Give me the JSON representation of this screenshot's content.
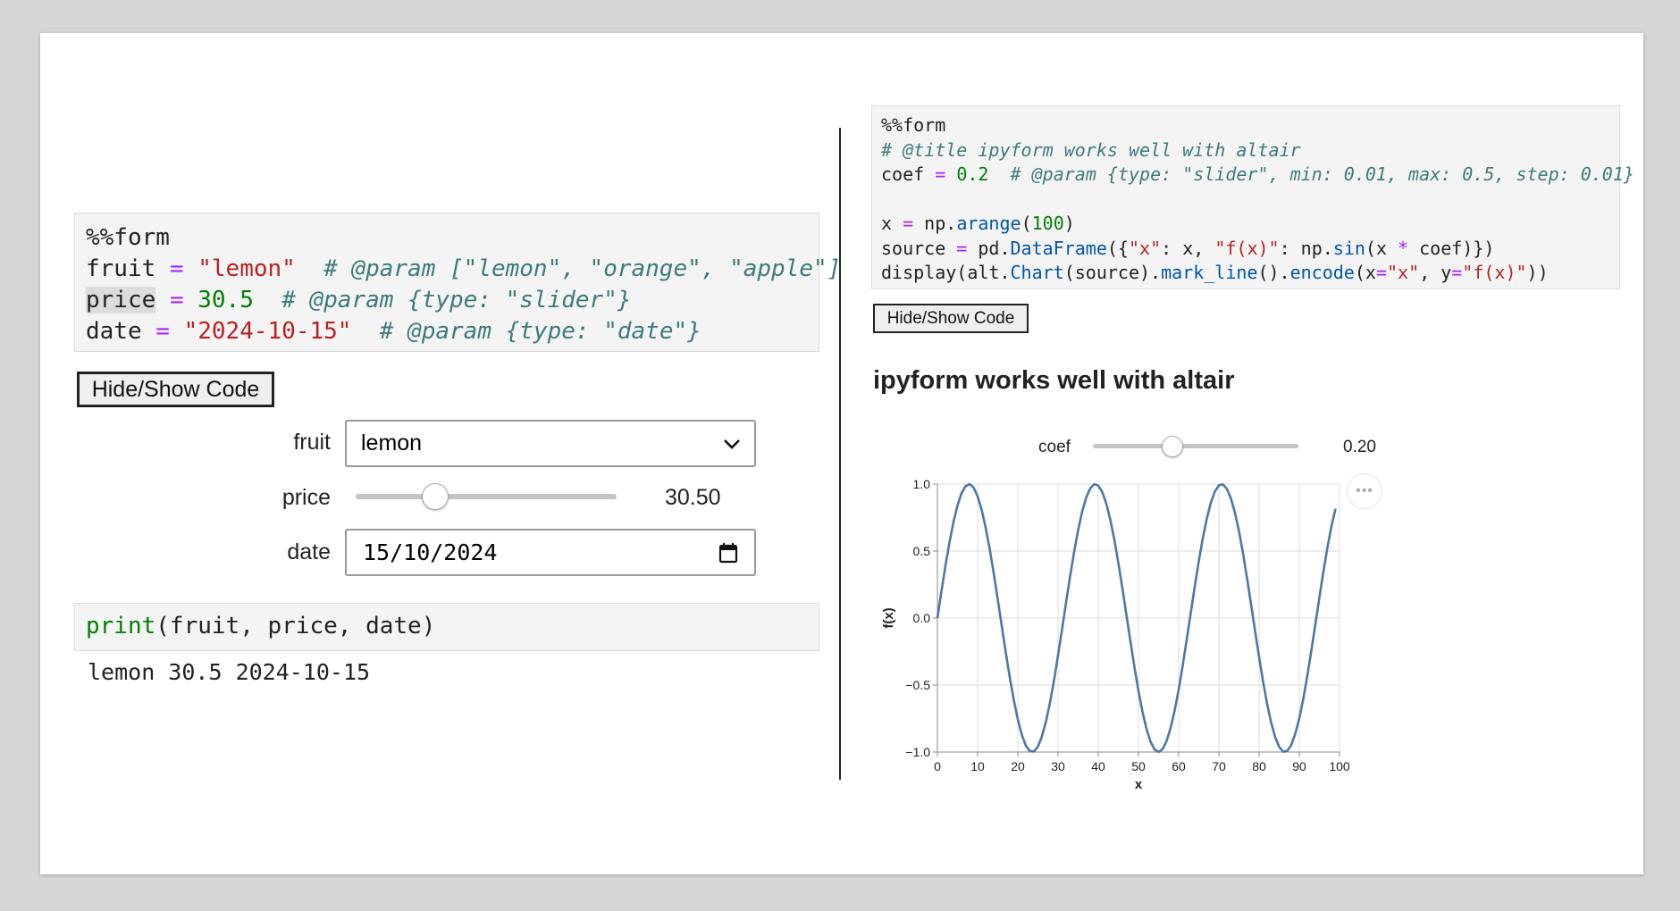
{
  "left": {
    "code_lines": [
      [
        {
          "t": "%%form",
          "c": ""
        }
      ],
      [
        {
          "t": "fruit ",
          "c": ""
        },
        {
          "t": "=",
          "c": "kw-op"
        },
        {
          "t": " ",
          "c": ""
        },
        {
          "t": "\"lemon\"",
          "c": "str"
        },
        {
          "t": "  ",
          "c": ""
        },
        {
          "t": "# @param [\"lemon\", \"orange\", \"apple\"]",
          "c": "com"
        }
      ],
      [
        {
          "t": "price",
          "c": "hl"
        },
        {
          "t": " ",
          "c": ""
        },
        {
          "t": "=",
          "c": "kw-op"
        },
        {
          "t": " ",
          "c": ""
        },
        {
          "t": "30.5",
          "c": "num"
        },
        {
          "t": "  ",
          "c": ""
        },
        {
          "t": "# @param {type: \"slider\"}",
          "c": "com"
        }
      ],
      [
        {
          "t": "date ",
          "c": ""
        },
        {
          "t": "=",
          "c": "kw-op"
        },
        {
          "t": " ",
          "c": ""
        },
        {
          "t": "\"2024-10-15\"",
          "c": "str"
        },
        {
          "t": "  ",
          "c": ""
        },
        {
          "t": "# @param {type: \"date\"}",
          "c": "com"
        }
      ]
    ],
    "toggle_label": "Hide/Show Code",
    "form": {
      "fruit_label": "fruit",
      "fruit_value": "lemon",
      "price_label": "price",
      "price_value": "30.50",
      "price_fraction": 0.305,
      "date_label": "date",
      "date_value": "15/10/2024"
    },
    "print_code": [
      [
        {
          "t": "print",
          "c": "bi"
        },
        {
          "t": "(fruit, price, date)",
          "c": ""
        }
      ]
    ],
    "output": "lemon 30.5 2024-10-15"
  },
  "right": {
    "code_lines": [
      [
        {
          "t": "%%form",
          "c": ""
        }
      ],
      [
        {
          "t": "# @title ipyform works well with altair",
          "c": "com"
        }
      ],
      [
        {
          "t": "coef ",
          "c": ""
        },
        {
          "t": "=",
          "c": "kw-op"
        },
        {
          "t": " ",
          "c": ""
        },
        {
          "t": "0.2",
          "c": "num"
        },
        {
          "t": "  ",
          "c": ""
        },
        {
          "t": "# @param {type: \"slider\", min: 0.01, max: 0.5, step: 0.01}",
          "c": "com"
        }
      ],
      [
        {
          "t": " ",
          "c": ""
        }
      ],
      [
        {
          "t": "x ",
          "c": ""
        },
        {
          "t": "=",
          "c": "kw-op"
        },
        {
          "t": " np.",
          "c": ""
        },
        {
          "t": "arange",
          "c": "fn"
        },
        {
          "t": "(",
          "c": ""
        },
        {
          "t": "100",
          "c": "num"
        },
        {
          "t": ")",
          "c": ""
        }
      ],
      [
        {
          "t": "source ",
          "c": ""
        },
        {
          "t": "=",
          "c": "kw-op"
        },
        {
          "t": " pd.",
          "c": ""
        },
        {
          "t": "DataFrame",
          "c": "fn"
        },
        {
          "t": "({",
          "c": ""
        },
        {
          "t": "\"x\"",
          "c": "str"
        },
        {
          "t": ": x, ",
          "c": ""
        },
        {
          "t": "\"f(x)\"",
          "c": "str"
        },
        {
          "t": ": np.",
          "c": ""
        },
        {
          "t": "sin",
          "c": "fn"
        },
        {
          "t": "(x ",
          "c": ""
        },
        {
          "t": "*",
          "c": "kw-op"
        },
        {
          "t": " coef)})",
          "c": ""
        }
      ],
      [
        {
          "t": "display(alt.",
          "c": ""
        },
        {
          "t": "Chart",
          "c": "fn"
        },
        {
          "t": "(source).",
          "c": ""
        },
        {
          "t": "mark_line",
          "c": "fn"
        },
        {
          "t": "().",
          "c": ""
        },
        {
          "t": "encode",
          "c": "fn"
        },
        {
          "t": "(x",
          "c": ""
        },
        {
          "t": "=",
          "c": "kw-op"
        },
        {
          "t": "\"x\"",
          "c": "str"
        },
        {
          "t": ", y",
          "c": ""
        },
        {
          "t": "=",
          "c": "kw-op"
        },
        {
          "t": "\"f(x)\"",
          "c": "str"
        },
        {
          "t": "))",
          "c": ""
        }
      ]
    ],
    "toggle_label": "Hide/Show Code",
    "chart_heading": "ipyform works well with altair",
    "coef_label": "coef",
    "coef_value": "0.20",
    "coef_fraction": 0.388,
    "more_label": "•••"
  },
  "colors": {
    "line": "#4c78a8",
    "grid": "#dddddd",
    "axis": "#888888"
  },
  "chart_data": {
    "type": "line",
    "title": "",
    "xlabel": "x",
    "ylabel": "f(x)",
    "xlim": [
      0,
      100
    ],
    "ylim": [
      -1.0,
      1.0
    ],
    "xticks": [
      0,
      10,
      20,
      30,
      40,
      50,
      60,
      70,
      80,
      90,
      100
    ],
    "yticks": [
      1.0,
      0.5,
      0.0,
      -0.5,
      -1.0
    ],
    "ytick_labels": [
      "1.0",
      "0.5",
      "0.0",
      "−0.5",
      "−1.0"
    ],
    "grid": true,
    "series": [
      {
        "x": [
          0,
          1,
          2,
          3,
          4,
          5,
          6,
          7,
          8,
          9,
          10,
          11,
          12,
          13,
          14,
          15,
          16,
          17,
          18,
          19,
          20,
          21,
          22,
          23,
          24,
          25,
          26,
          27,
          28,
          29,
          30,
          31,
          32,
          33,
          34,
          35,
          36,
          37,
          38,
          39,
          40,
          41,
          42,
          43,
          44,
          45,
          46,
          47,
          48,
          49,
          50,
          51,
          52,
          53,
          54,
          55,
          56,
          57,
          58,
          59,
          60,
          61,
          62,
          63,
          64,
          65,
          66,
          67,
          68,
          69,
          70,
          71,
          72,
          73,
          74,
          75,
          76,
          77,
          78,
          79,
          80,
          81,
          82,
          83,
          84,
          85,
          86,
          87,
          88,
          89,
          90,
          91,
          92,
          93,
          94,
          95,
          96,
          97,
          98,
          99
        ],
        "y": [
          0,
          0.199,
          0.389,
          0.565,
          0.717,
          0.841,
          0.932,
          0.985,
          1.0,
          0.974,
          0.909,
          0.808,
          0.675,
          0.516,
          0.335,
          0.141,
          -0.058,
          -0.256,
          -0.443,
          -0.612,
          -0.757,
          -0.872,
          -0.952,
          -0.994,
          -0.996,
          -0.959,
          -0.883,
          -0.772,
          -0.631,
          -0.465,
          -0.279,
          -0.083,
          0.117,
          0.312,
          0.494,
          0.657,
          0.794,
          0.899,
          0.968,
          0.999,
          0.989,
          0.941,
          0.855,
          0.735,
          0.585,
          0.412,
          0.223,
          0.025,
          -0.174,
          -0.366,
          -0.544,
          -0.7,
          -0.828,
          -0.923,
          -0.981,
          -1.0,
          -0.978,
          -0.917,
          -0.82,
          -0.69,
          -0.534,
          -0.354,
          -0.161,
          0.038,
          0.236,
          0.425,
          0.596,
          0.743,
          0.862,
          0.945,
          0.991,
          0.998,
          0.964,
          0.892,
          0.785,
          0.647,
          0.483,
          0.298,
          0.102,
          -0.097,
          -0.293,
          -0.476,
          -0.642,
          -0.781,
          -0.889,
          -0.962,
          -0.998,
          -0.992,
          -0.947,
          -0.864,
          -0.748,
          -0.601,
          -0.43,
          -0.242,
          -0.044,
          0.155,
          0.349,
          0.528,
          0.686,
          0.816
        ]
      }
    ]
  }
}
